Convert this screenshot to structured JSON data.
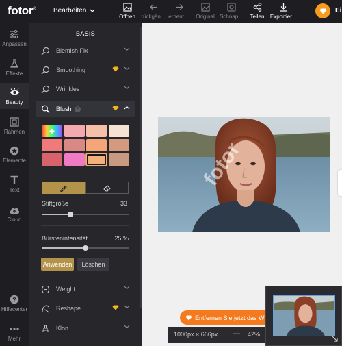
{
  "topbar": {
    "logo": "fotor",
    "logo_mark": "®",
    "edit_label": "Bearbeiten",
    "items": [
      {
        "label": "Öffnen",
        "icon": "image-icon",
        "dim": false
      },
      {
        "label": "rückgän...",
        "icon": "undo-icon",
        "dim": true
      },
      {
        "label": "erneut ...",
        "icon": "redo-icon",
        "dim": true
      },
      {
        "label": "Original",
        "icon": "original-icon",
        "dim": true
      },
      {
        "label": "Schnap...",
        "icon": "snapshot-icon",
        "dim": true
      },
      {
        "label": "Teilen",
        "icon": "share-icon",
        "dim": false
      },
      {
        "label": "Exportier...",
        "icon": "download-icon",
        "dim": false
      }
    ],
    "user_name": "Ei"
  },
  "leftnav": {
    "items": [
      {
        "label": "Anpassen",
        "icon": "sliders-icon"
      },
      {
        "label": "Effekte",
        "icon": "flask-icon"
      },
      {
        "label": "Beauty",
        "icon": "eye-icon",
        "active": true
      },
      {
        "label": "Rahmen",
        "icon": "frame-icon"
      },
      {
        "label": "Elemente",
        "icon": "star-icon"
      },
      {
        "label": "Text",
        "icon": "text-icon"
      },
      {
        "label": "Cloud",
        "icon": "cloud-icon"
      },
      {
        "label": "Hilfecenter",
        "icon": "help-icon"
      },
      {
        "label": "Mehr",
        "icon": "more-icon"
      }
    ]
  },
  "panel": {
    "title": "BASIS",
    "tools": {
      "blemish": "Blemish Fix",
      "smoothing": "Smoothing",
      "wrinkles": "Wrinkles",
      "blush": "Blush",
      "weight": "Weight",
      "reshape": "Reshape",
      "klon": "Klon"
    },
    "blush": {
      "swatches": [
        "rainbow",
        "#f4a8b0",
        "#f6bfa8",
        "#f4e2d2",
        "#f07a7a",
        "#d98884",
        "#f4a679",
        "#d49a80",
        "#d9636b",
        "#f07ac4",
        "#f4b07a",
        "#c89a82"
      ],
      "selected_index": 10,
      "size_label": "Stiftgröße",
      "size_value": "33",
      "size_fraction": 0.33,
      "intensity_label": "Bürstenintensität",
      "intensity_value": "25 %",
      "intensity_fraction": 0.5,
      "apply_label": "Anwenden",
      "clear_label": "Löschen"
    }
  },
  "canvas": {
    "watermark": "fotor",
    "promo_text": "Entfernen Sie jetzt das W",
    "dimensions": "1000px × 666px",
    "zoom": "42%",
    "accent": "#b39249",
    "promo_color": "#f47a1d"
  }
}
